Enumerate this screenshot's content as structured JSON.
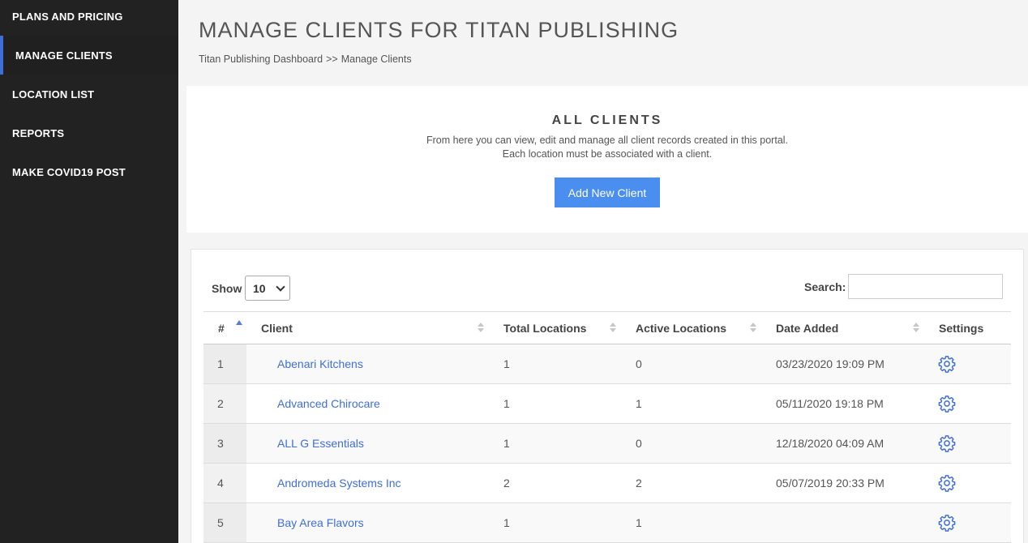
{
  "sidebar": {
    "items": [
      {
        "label": "PLANS AND PRICING",
        "active": false
      },
      {
        "label": "MANAGE CLIENTS",
        "active": true
      },
      {
        "label": "LOCATION LIST",
        "active": false
      },
      {
        "label": "REPORTS",
        "active": false
      },
      {
        "label": "MAKE COVID19 POST",
        "active": false
      }
    ]
  },
  "header": {
    "title": "MANAGE CLIENTS FOR TITAN PUBLISHING",
    "breadcrumb": {
      "parent": "Titan Publishing Dashboard",
      "separator": ">>",
      "current": "Manage Clients"
    }
  },
  "intro": {
    "heading": "ALL CLIENTS",
    "line1": "From here you can view, edit and manage all client records created in this portal.",
    "line2": "Each location must be associated with a client.",
    "add_button": "Add New Client"
  },
  "table_controls": {
    "show_label": "Show",
    "show_value": "10",
    "search_label": "Search:",
    "search_value": ""
  },
  "table": {
    "columns": [
      "#",
      "Client",
      "Total Locations",
      "Active Locations",
      "Date Added",
      "Settings"
    ],
    "rows": [
      {
        "num": "1",
        "client": "Abenari Kitchens",
        "total": "1",
        "active": "0",
        "date": "03/23/2020 19:09 PM"
      },
      {
        "num": "2",
        "client": "Advanced Chirocare",
        "total": "1",
        "active": "1",
        "date": "05/11/2020 19:18 PM"
      },
      {
        "num": "3",
        "client": "ALL G Essentials",
        "total": "1",
        "active": "0",
        "date": "12/18/2020 04:09 AM"
      },
      {
        "num": "4",
        "client": "Andromeda Systems Inc",
        "total": "2",
        "active": "2",
        "date": "05/07/2019 20:33 PM"
      },
      {
        "num": "5",
        "client": "Bay Area Flavors",
        "total": "1",
        "active": "1",
        "date": ""
      }
    ]
  },
  "colors": {
    "sidebar_bg": "#222222",
    "accent": "#3f6fd6",
    "button": "#4a8ff0"
  },
  "icons": {
    "settings": "gear-icon",
    "sort": "sort-icon",
    "dropdown": "chevron-down-icon"
  }
}
